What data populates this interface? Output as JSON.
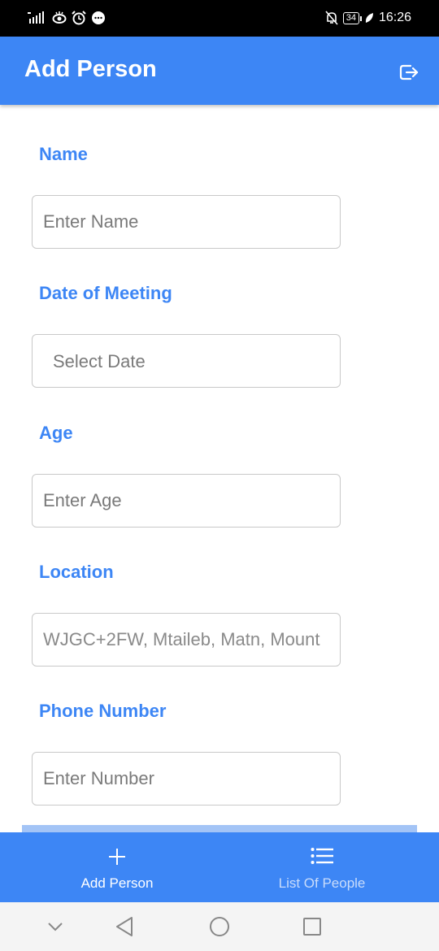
{
  "status_bar": {
    "time": "16:26",
    "battery": "34"
  },
  "header": {
    "title": "Add Person"
  },
  "form": {
    "name": {
      "label": "Name",
      "placeholder": "Enter Name"
    },
    "date": {
      "label": "Date of Meeting",
      "placeholder": "Select Date"
    },
    "age": {
      "label": "Age",
      "placeholder": "Enter Age"
    },
    "location": {
      "label": "Location",
      "value": "WJGC+2FW, Mtaileb, Matn, Mount"
    },
    "phone": {
      "label": "Phone Number",
      "placeholder": "Enter Number"
    }
  },
  "bottom_nav": {
    "add_person": {
      "label": "Add Person",
      "color": "#ffffff"
    },
    "list_people": {
      "label": "List Of People",
      "color": "#c9dcfb"
    }
  },
  "colors": {
    "accent": "#3d86f5",
    "status_bar": "#000000"
  },
  "icons": [
    "signal-icon",
    "eye-icon",
    "alarm-icon",
    "message-icon",
    "mute-icon",
    "battery-icon",
    "leaf-icon",
    "logout-icon",
    "plus-icon",
    "list-icon",
    "back-icon",
    "home-icon",
    "recents-icon",
    "chevron-down-icon"
  ]
}
